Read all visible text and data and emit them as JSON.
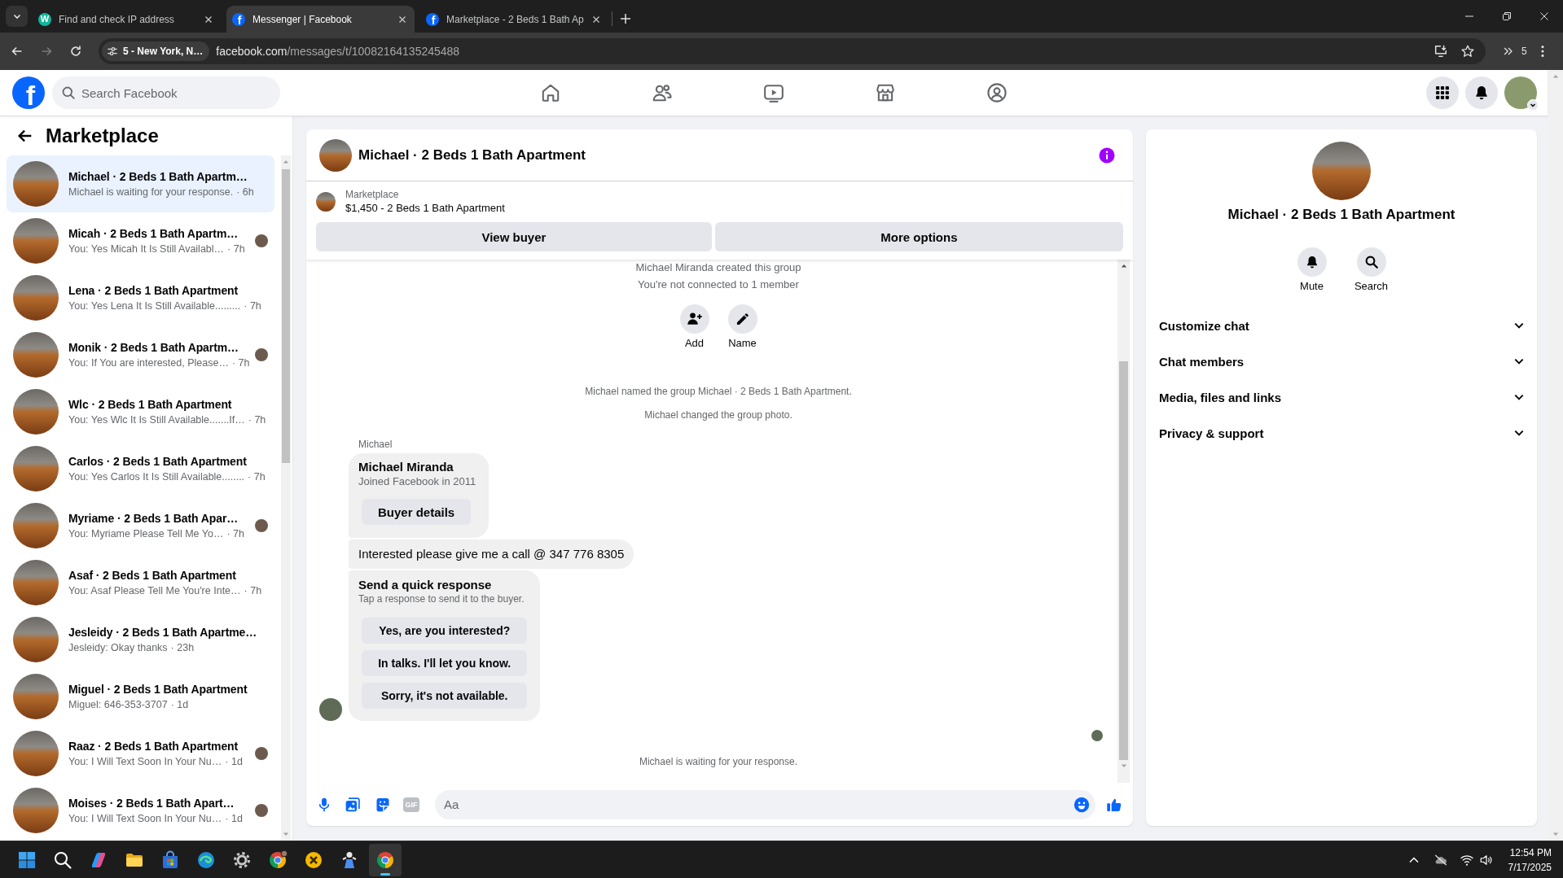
{
  "browser": {
    "tabs": [
      {
        "title": "Find and check IP address",
        "kind": "letter",
        "favicon_text": "W",
        "selected": false
      },
      {
        "title": "Messenger | Facebook",
        "kind": "facebook",
        "favicon_text": "f",
        "selected": true
      },
      {
        "title": "Marketplace - 2 Beds 1 Bath Ap",
        "kind": "facebook",
        "favicon_text": "f",
        "selected": false
      }
    ],
    "site_chip": "5 - New York, N…",
    "url": {
      "host": "facebook.com",
      "path": "/messages/t/10082164135245488"
    },
    "profile_label": "5"
  },
  "facebook": {
    "logo_text": "f",
    "search_placeholder": "Search Facebook"
  },
  "sidebar": {
    "title": "Marketplace",
    "conversations": [
      {
        "title": "Michael · 2 Beds 1 Bath Apartm…",
        "snippet": "Michael is waiting for your response.",
        "time": "· 6h",
        "selected": true,
        "seen": false
      },
      {
        "title": "Micah · 2 Beds 1 Bath Apartm…",
        "snippet": "You: Yes Micah It Is Still Availabl…",
        "time": "· 7h",
        "selected": false,
        "seen": true
      },
      {
        "title": "Lena · 2 Beds 1 Bath Apartment",
        "snippet": "You: Yes Lena It Is Still Available.........",
        "time": "· 7h",
        "selected": false,
        "seen": false
      },
      {
        "title": "Monik · 2 Beds 1 Bath Apartm…",
        "snippet": "You: If You are interested, Please…",
        "time": "· 7h",
        "selected": false,
        "seen": true
      },
      {
        "title": "Wlc · 2 Beds 1 Bath Apartment",
        "snippet": "You: Yes Wlc It Is Still Available.......If…",
        "time": "· 7h",
        "selected": false,
        "seen": false
      },
      {
        "title": "Carlos · 2 Beds 1 Bath Apartment",
        "snippet": "You: Yes Carlos It Is Still Available........",
        "time": "· 7h",
        "selected": false,
        "seen": false
      },
      {
        "title": "Myriame · 2 Beds 1 Bath Apar…",
        "snippet": "You: Myriame Please Tell Me Yo…",
        "time": "· 7h",
        "selected": false,
        "seen": true
      },
      {
        "title": "Asaf · 2 Beds 1 Bath Apartment",
        "snippet": "You: Asaf Please Tell Me You're Inte…",
        "time": "· 7h",
        "selected": false,
        "seen": false
      },
      {
        "title": "Jesleidy · 2 Beds 1 Bath Apartme…",
        "snippet": "Jesleidy: Okay thanks",
        "time": "· 23h",
        "selected": false,
        "seen": false
      },
      {
        "title": "Miguel · 2 Beds 1 Bath Apartment",
        "snippet": "Miguel: 646-353-3707",
        "time": "· 1d",
        "selected": false,
        "seen": false
      },
      {
        "title": "Raaz · 2 Beds 1 Bath Apartment",
        "snippet": "You: I Will Text Soon In Your Nu…",
        "time": "· 1d",
        "selected": false,
        "seen": true
      },
      {
        "title": "Moises · 2 Beds 1 Bath Apart…",
        "snippet": "You: I Will Text Soon In Your Nu…",
        "time": "· 1d",
        "selected": false,
        "seen": true
      }
    ]
  },
  "chat": {
    "title": "Michael · 2 Beds 1 Bath Apartment",
    "listing": {
      "label": "Marketplace",
      "title": "$1,450 - 2 Beds 1 Bath Apartment",
      "buttons": [
        "View buyer",
        "More options"
      ]
    },
    "thread": {
      "notices": [
        "Michael Miranda created this group",
        "You're not connected to 1 member"
      ],
      "group_actions": [
        {
          "kind": "add_person",
          "label": "Add"
        },
        {
          "kind": "rename",
          "label": "Name"
        }
      ],
      "events": [
        "Michael named the group Michael · 2 Beds 1 Bath Apartment.",
        "Michael changed the group photo."
      ],
      "message_group": {
        "sender": "Michael",
        "messages": [
          {
            "kind": "profile_card",
            "name": "Michael Miranda",
            "detail": "Joined Facebook in 2011",
            "button": "Buyer details"
          },
          {
            "kind": "text",
            "text": "Interested please give me a call @ 347 776 8305"
          },
          {
            "kind": "quick_replies",
            "title": "Send a quick response",
            "hint": "Tap a response to send it to the buyer.",
            "options": [
              "Yes, are you interested?",
              "In talks. I'll let you know.",
              "Sorry, it's not available."
            ]
          }
        ]
      },
      "seen": true,
      "status": "Michael is waiting for your response."
    },
    "composer": {
      "gif_label": "GIF",
      "placeholder": "Aa"
    }
  },
  "details": {
    "title": "Michael · 2 Beds 1 Bath Apartment",
    "actions": [
      {
        "kind": "mute",
        "label": "Mute"
      },
      {
        "kind": "search",
        "label": "Search"
      }
    ],
    "sections": [
      {
        "label": "Customize chat",
        "expanded": false
      },
      {
        "label": "Chat members",
        "expanded": false
      },
      {
        "label": "Media, files and links",
        "expanded": false
      },
      {
        "label": "Privacy & support",
        "expanded": false
      }
    ]
  },
  "taskbar": {
    "apps": [
      {
        "kind": "start",
        "selected": false
      },
      {
        "kind": "search",
        "selected": false
      },
      {
        "kind": "swirl",
        "selected": false
      },
      {
        "kind": "folder",
        "selected": false
      },
      {
        "kind": "bag",
        "selected": false
      },
      {
        "kind": "wave",
        "selected": false
      },
      {
        "kind": "gear",
        "selected": false
      },
      {
        "kind": "tricolor_badge",
        "selected": false
      },
      {
        "kind": "xmark",
        "selected": false
      },
      {
        "kind": "figure",
        "selected": false
      },
      {
        "kind": "tricolor",
        "selected": true
      }
    ],
    "clock": {
      "time": "12:54 PM",
      "date": "7/17/2025"
    }
  }
}
